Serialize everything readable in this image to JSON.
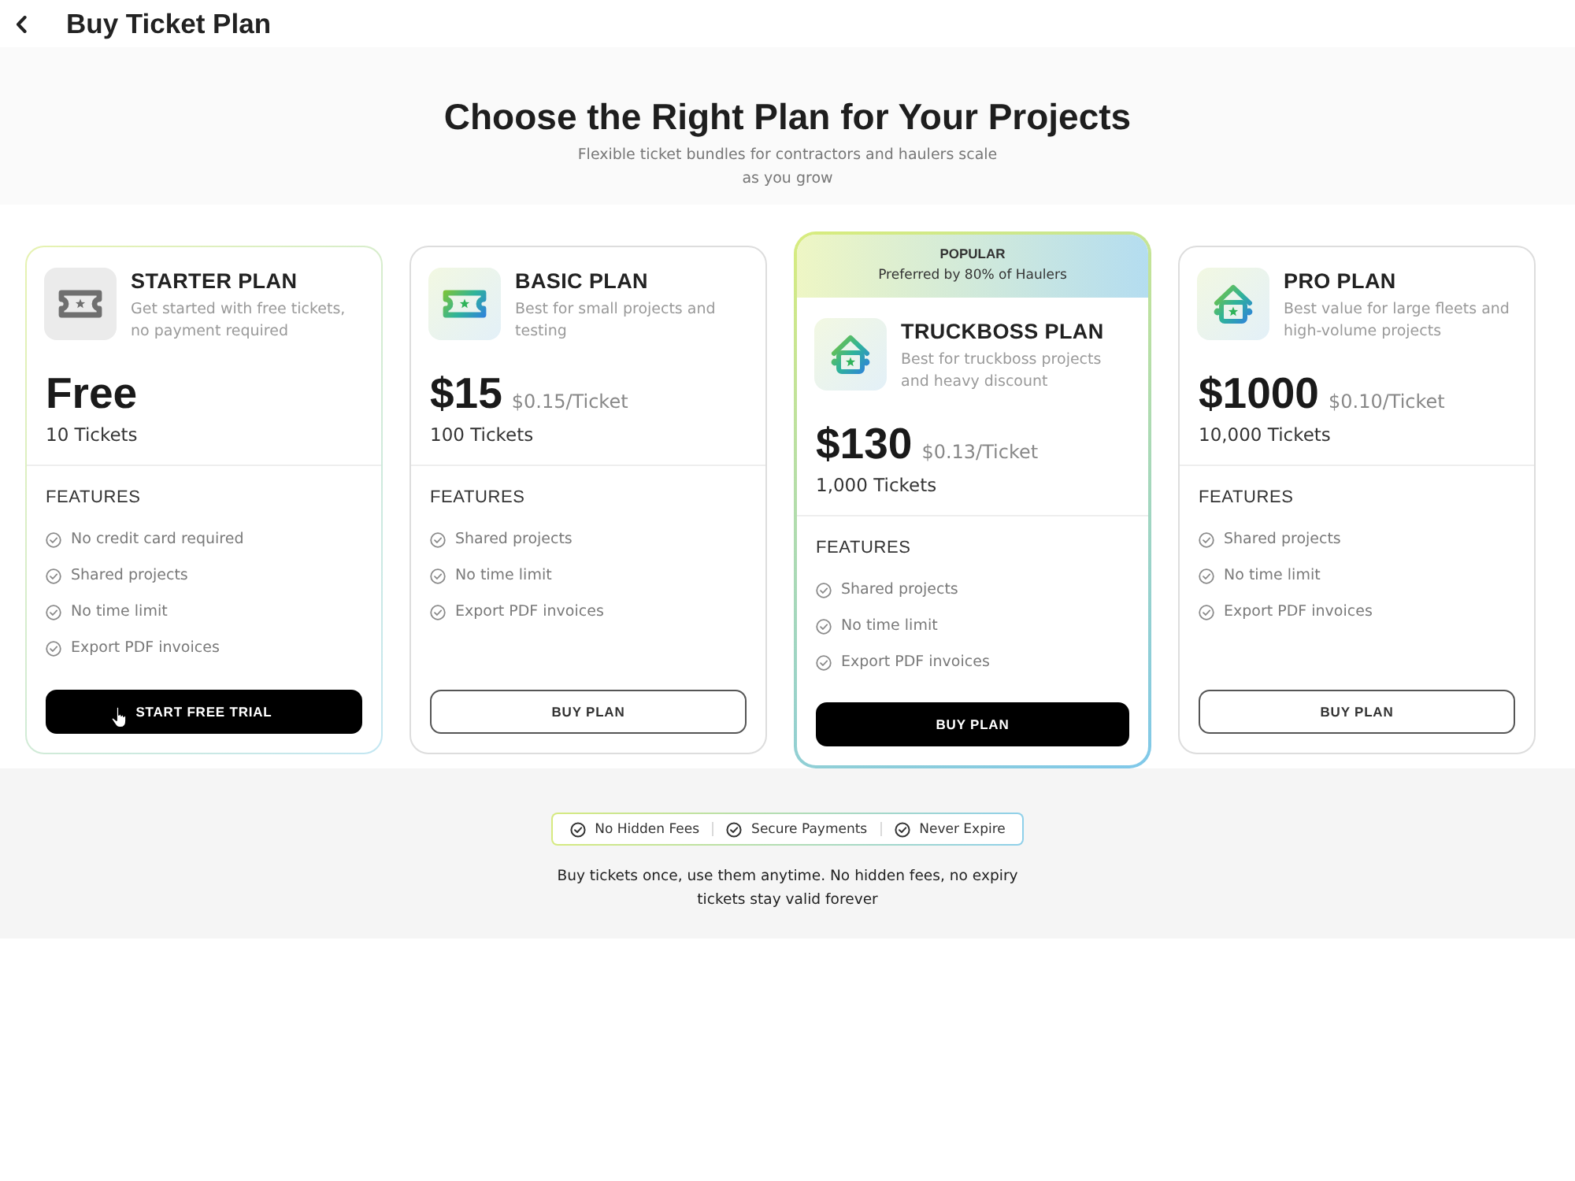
{
  "header": {
    "title": "Buy Ticket Plan"
  },
  "hero": {
    "heading": "Choose the Right Plan for Your Projects",
    "subtitle": "Flexible ticket bundles for contractors and haulers scale as you grow"
  },
  "plans": [
    {
      "kind": "free",
      "hovered": true,
      "name": "STARTER PLAN",
      "description": "Get started with free tickets, no payment required",
      "price": "Free",
      "tickets": "10 Tickets",
      "features_heading": "FEATURES",
      "features": [
        "No credit card required",
        "Shared projects",
        "No time limit",
        "Export PDF invoices"
      ],
      "button": {
        "label": "START FREE TRIAL",
        "kind": "primary"
      }
    },
    {
      "kind": "ticket",
      "hovered": false,
      "name": "BASIC PLAN",
      "description": "Best for small projects and testing",
      "price": "$15",
      "unit_price": "$0.15/Ticket",
      "tickets": "100 Tickets",
      "features_heading": "FEATURES",
      "features": [
        "Shared projects",
        "No time limit",
        "Export PDF invoices"
      ],
      "button": {
        "label": "BUY PLAN",
        "kind": "outline"
      }
    },
    {
      "kind": "fleet",
      "hovered": false,
      "badge": {
        "label": "POPULAR",
        "caption": "Preferred by 80% of Haulers"
      },
      "name": "TRUCKBOSS PLAN",
      "description": "Best for truckboss projects and heavy discount",
      "price": "$130",
      "unit_price": "$0.13/Ticket",
      "tickets": "1,000 Tickets",
      "features_heading": "FEATURES",
      "features": [
        "Shared projects",
        "No time limit",
        "Export PDF invoices"
      ],
      "button": {
        "label": "BUY PLAN",
        "kind": "primary"
      }
    },
    {
      "kind": "fleet",
      "hovered": false,
      "name": "PRO PLAN",
      "description": "Best value for large fleets and high-volume projects",
      "price": "$1000",
      "unit_price": "$0.10/Ticket",
      "tickets": "10,000 Tickets",
      "features_heading": "FEATURES",
      "features": [
        "Shared projects",
        "No time limit",
        "Export PDF invoices"
      ],
      "button": {
        "label": "BUY PLAN",
        "kind": "outline"
      }
    }
  ],
  "guarantees": [
    "No Hidden Fees",
    "Secure Payments",
    "Never Expire"
  ],
  "footer_note": "Buy tickets once, use them anytime. No hidden fees, no expiry tickets stay valid forever"
}
